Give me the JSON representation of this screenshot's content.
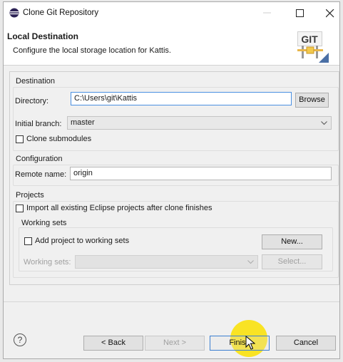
{
  "window": {
    "title": "Clone Git Repository"
  },
  "header": {
    "title": "Local Destination",
    "description": "Configure the local storage location for Kattis.",
    "logo_text": "GIT"
  },
  "destination": {
    "section_title": "Destination",
    "directory_label": "Directory:",
    "directory_value": "C:\\Users\\git\\Kattis",
    "browse_label": "Browse",
    "initial_branch_label": "Initial branch:",
    "initial_branch_value": "master",
    "clone_submodules_label": "Clone submodules",
    "clone_submodules_checked": false
  },
  "configuration": {
    "section_title": "Configuration",
    "remote_name_label": "Remote name:",
    "remote_name_value": "origin"
  },
  "projects": {
    "section_title": "Projects",
    "import_label": "Import all existing Eclipse projects after clone finishes",
    "import_checked": false,
    "working_sets_title": "Working sets",
    "add_to_working_sets_label": "Add project to working sets",
    "add_to_working_sets_checked": false,
    "new_button_label": "New...",
    "working_sets_label": "Working sets:",
    "working_sets_value": "",
    "select_button_label": "Select..."
  },
  "footer": {
    "help_glyph": "?",
    "back_label": "< Back",
    "next_label": "Next >",
    "finish_label": "Finish",
    "cancel_label": "Cancel"
  },
  "colors": {
    "highlight": "#fae100",
    "focus_border": "#4a90e2",
    "default_button_border": "#3c7fd1"
  }
}
